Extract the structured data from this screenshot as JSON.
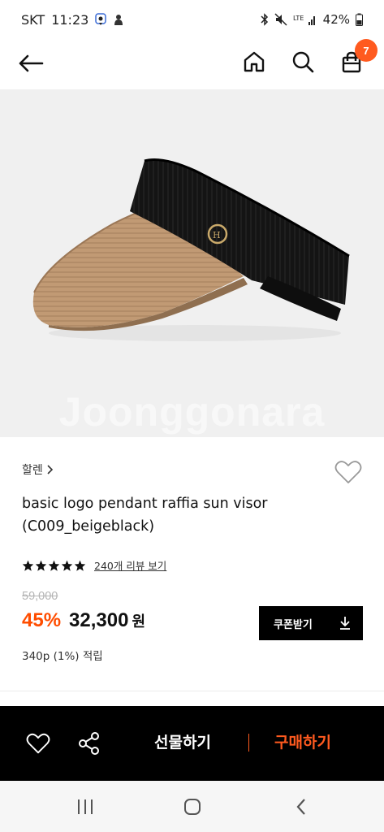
{
  "status_bar": {
    "carrier": "SKT",
    "time": "11:23",
    "network": "LTE",
    "battery": "42%"
  },
  "cart": {
    "count": "7"
  },
  "image": {
    "watermark": "Joonggonara"
  },
  "product": {
    "brand": "할렌",
    "title_line1": "basic logo pendant raffia sun visor",
    "title_line2": "(C009_beigeblack)",
    "rating": 5,
    "review_link": "240개 리뷰 보기",
    "original_price": "59,000",
    "discount": "45%",
    "sale_price": "32,300",
    "currency": "원",
    "points": "340p (1%) 적립",
    "coupon_label": "쿠폰받기"
  },
  "actions": {
    "gift_label": "선물하기",
    "buy_label": "구매하기"
  },
  "colors": {
    "accent": "#ff5a1f",
    "discount": "#ff4d00",
    "action_bar": "#000000"
  },
  "icons": [
    "back-arrow-icon",
    "home-icon",
    "search-icon",
    "shopping-bag-icon",
    "chevron-right-icon",
    "heart-icon",
    "star-icon",
    "download-icon",
    "share-icon"
  ]
}
